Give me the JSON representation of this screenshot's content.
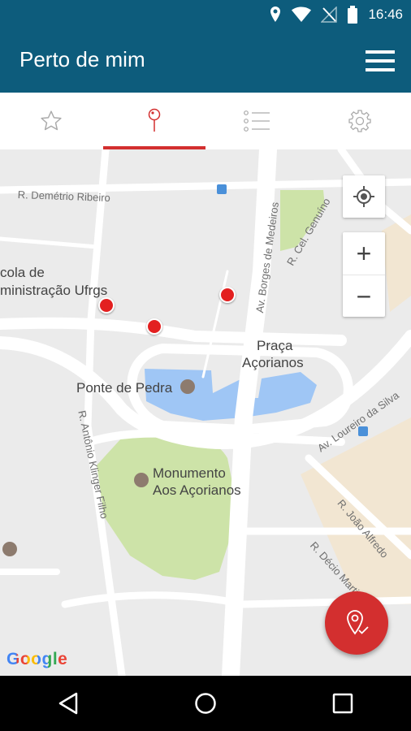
{
  "status_bar": {
    "time": "16:46"
  },
  "app_bar": {
    "title": "Perto de mim"
  },
  "tabs": [
    {
      "id": "favorites",
      "icon": "star-icon",
      "active": false
    },
    {
      "id": "nearby",
      "icon": "map-pin-icon",
      "active": true
    },
    {
      "id": "list",
      "icon": "list-icon",
      "active": false
    },
    {
      "id": "settings",
      "icon": "gear-icon",
      "active": false
    }
  ],
  "map": {
    "labels": {
      "escola": "cola de",
      "escola2": "ministração Ufrgs",
      "praca": "Praça",
      "praca2": "Açorianos",
      "ponte": "Ponte de Pedra",
      "monumento": "Monumento",
      "monumento2": "Aos Açorianos"
    },
    "streets": {
      "demetrio": "R. Demétrio Ribeiro",
      "borges": "Av. Borges de Medeiros",
      "genuino": "R. Cel. Genuíno",
      "loureiro": "Av. Loureiro da Silva",
      "antonio": "R. Antônio Klinger Filho",
      "joao": "R. João Alfredo",
      "decio": "R. Décio Martins Costa"
    },
    "zoom_in": "+",
    "zoom_out": "−",
    "attribution": "Google"
  },
  "colors": {
    "primary": "#0d5c7c",
    "accent": "#d32f2f",
    "park": "#cde3a8",
    "water": "#9fc6f5"
  }
}
